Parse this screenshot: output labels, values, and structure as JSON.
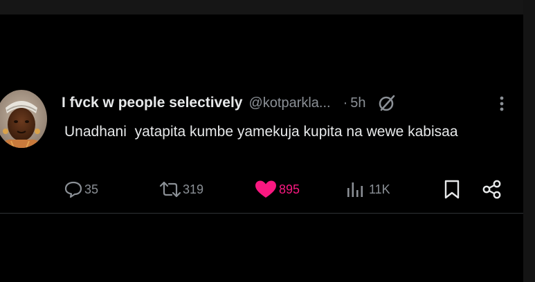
{
  "tweet": {
    "display_name": "I fvck w people selectively",
    "handle": "@kotparkla...",
    "separator": "·",
    "time": "5h",
    "text": "Unadhani  yatapita kumbe yamekuja kupita na wewe kabisaa",
    "stats": {
      "replies": "35",
      "reposts": "319",
      "likes": "895",
      "views": "11K"
    }
  },
  "colors": {
    "background": "#000000",
    "text_primary": "#e7e9ea",
    "text_secondary": "#8b9096",
    "like_pink": "#f91880",
    "divider": "#2f3336"
  },
  "icons": {
    "reply": "reply-bubble-icon",
    "repost": "repost-arrows-icon",
    "like": "heart-filled-icon",
    "views": "bar-chart-icon",
    "bookmark": "bookmark-icon",
    "share": "share-nodes-icon",
    "grok": "grok-slash-circle-icon",
    "more": "vertical-ellipsis-icon"
  }
}
